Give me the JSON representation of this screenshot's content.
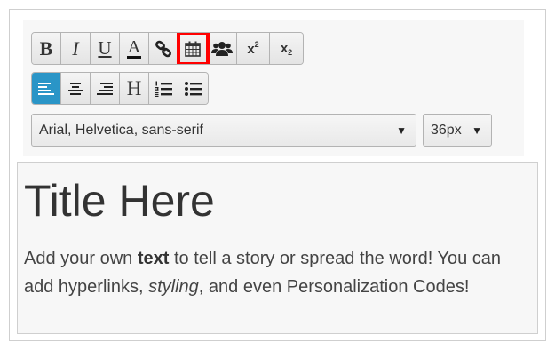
{
  "toolbar": {
    "row1": [
      {
        "name": "bold-button",
        "label": "B",
        "icon": "bold"
      },
      {
        "name": "italic-button",
        "label": "I",
        "icon": "italic"
      },
      {
        "name": "underline-button",
        "label": "U",
        "icon": "underline"
      },
      {
        "name": "font-color-button",
        "label": "A",
        "icon": "font-color"
      },
      {
        "name": "link-button",
        "icon": "link-icon"
      },
      {
        "name": "date-button",
        "icon": "calendar-icon",
        "highlighted": true
      },
      {
        "name": "personalization-button",
        "icon": "users-icon"
      },
      {
        "name": "superscript-button",
        "label": "x",
        "sup": "2",
        "icon": "superscript"
      },
      {
        "name": "subscript-button",
        "label": "x",
        "sub": "2",
        "icon": "subscript"
      }
    ],
    "row2": [
      {
        "name": "align-left-button",
        "icon": "align-left-icon",
        "active": true
      },
      {
        "name": "align-center-button",
        "icon": "align-center-icon"
      },
      {
        "name": "align-right-button",
        "icon": "align-right-icon"
      },
      {
        "name": "heading-button",
        "label": "H",
        "icon": "heading"
      },
      {
        "name": "ordered-list-button",
        "icon": "ordered-list-icon"
      },
      {
        "name": "unordered-list-button",
        "icon": "unordered-list-icon"
      }
    ],
    "font_family": "Arial, Helvetica, sans-serif",
    "font_size": "36px",
    "caret": "▼"
  },
  "editor": {
    "title": "Title Here",
    "body": {
      "pre": "Add your own ",
      "bold": "text",
      "mid": " to tell a story or spread the word! You can add hyperlinks, ",
      "italic": "styling",
      "post": ", and even Personalization Codes!"
    }
  },
  "colors": {
    "active_button": "#2a95c7",
    "highlight_frame": "#ff0000",
    "editor_background": "#f7f7f7"
  }
}
